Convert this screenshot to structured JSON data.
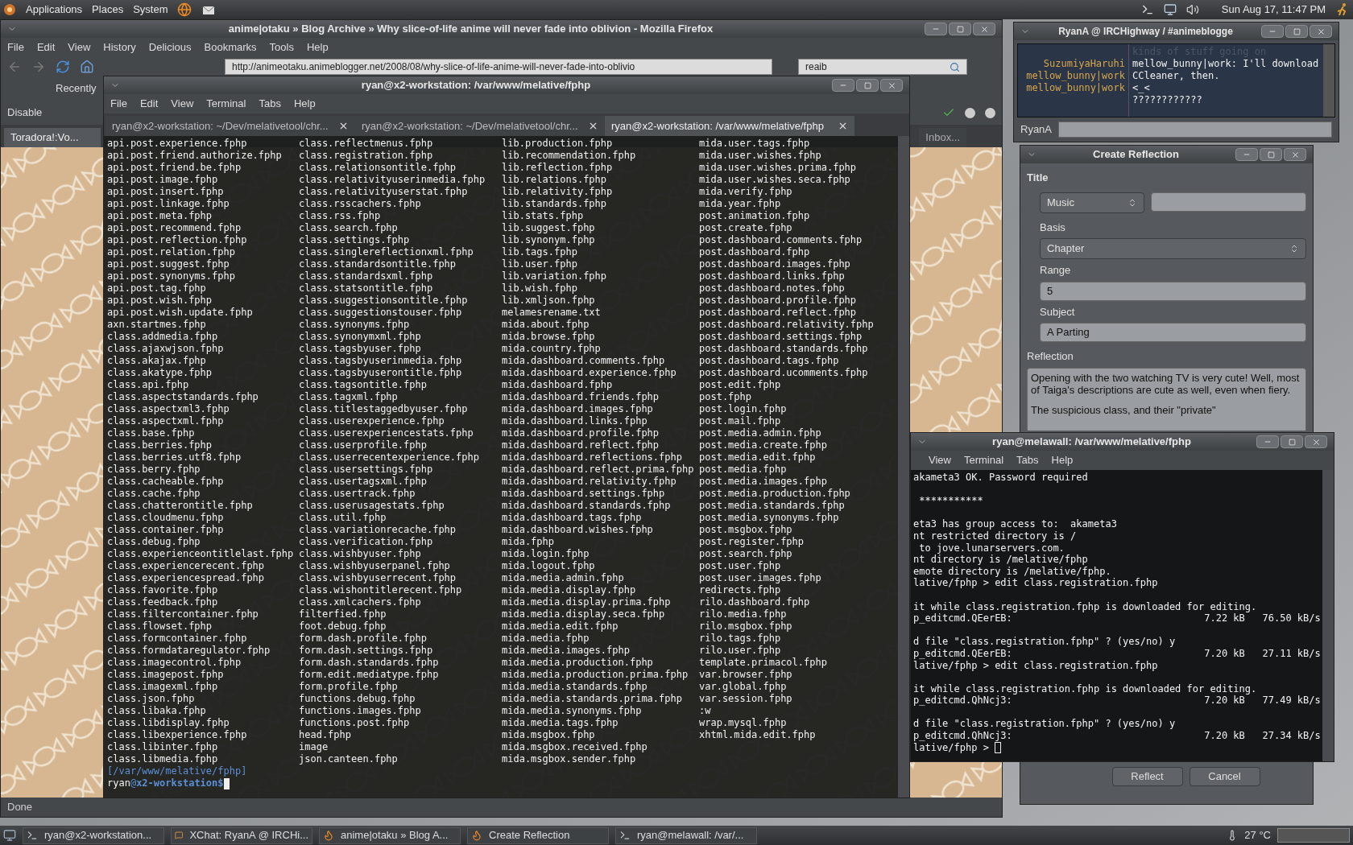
{
  "top_panel": {
    "menus": [
      "Applications",
      "Places",
      "System"
    ],
    "clock": "Sun Aug 17, 11:47 PM"
  },
  "firefox": {
    "title": "anime|otaku » Blog Archive » Why slice-of-life anime will never fade into oblivion - Mozilla Firefox",
    "menu": [
      "File",
      "Edit",
      "View",
      "History",
      "Delicious",
      "Bookmarks",
      "Tools",
      "Help"
    ],
    "url": "http://animeotaku.animeblogger.net/2008/08/why-slice-of-life-anime-will-never-fade-into-oblivio",
    "search": "reaib",
    "bookmark": "Recently",
    "toolbar_button": "Disable",
    "tabs": [
      {
        "label": "Toradora!:Vo...",
        "selected": true
      },
      {
        "label": "Inbox...",
        "selected": false
      }
    ],
    "status": "Done"
  },
  "terminal": {
    "title": "ryan@x2-workstation: /var/www/melative/fphp",
    "menu": [
      "File",
      "Edit",
      "View",
      "Terminal",
      "Tabs",
      "Help"
    ],
    "tabs": [
      {
        "label": "ryan@x2-workstation: ~/Dev/melativetool/chr...",
        "selected": false
      },
      {
        "label": "ryan@x2-workstation: ~/Dev/melativetool/chr...",
        "selected": false
      },
      {
        "label": "ryan@x2-workstation: /var/www/melative/fphp",
        "selected": true
      }
    ],
    "columns": [
      [
        "api.post.experience.fphp",
        "api.post.friend.authorize.fphp",
        "api.post.friend.be.fphp",
        "api.post.image.fphp",
        "api.post.insert.fphp",
        "api.post.linkage.fphp",
        "api.post.meta.fphp",
        "api.post.recommend.fphp",
        "api.post.reflection.fphp",
        "api.post.relation.fphp",
        "api.post.suggest.fphp",
        "api.post.synonyms.fphp",
        "api.post.tag.fphp",
        "api.post.wish.fphp",
        "api.post.wish.update.fphp",
        "axn.startmes.fphp",
        "class.addmedia.fphp",
        "class.ajaxwjson.fphp",
        "class.akajax.fphp",
        "class.akatype.fphp",
        "class.api.fphp",
        "class.aspectstandards.fphp",
        "class.aspectxml3.fphp",
        "class.aspectxml.fphp",
        "class.base.fphp",
        "class.berries.fphp",
        "class.berries.utf8.fphp",
        "class.berry.fphp",
        "class.cacheable.fphp",
        "class.cache.fphp",
        "class.chatterontitle.fphp",
        "class.cloudmenu.fphp",
        "class.container.fphp",
        "class.debug.fphp",
        "class.experienceontitlelast.fphp",
        "class.experiencerecent.fphp",
        "class.experiencespread.fphp",
        "class.favorite.fphp",
        "class.feedback.fphp",
        "class.filtercontainer.fphp",
        "class.flowset.fphp",
        "class.formcontainer.fphp",
        "class.formdataregulator.fphp",
        "class.imagecontrol.fphp",
        "class.imagepost.fphp",
        "class.imagexml.fphp",
        "class.json.fphp",
        "class.libaka.fphp",
        "class.libdisplay.fphp",
        "class.libexperience.fphp",
        "class.libinter.fphp",
        "class.libmedia.fphp"
      ],
      [
        "class.reflectmenus.fphp",
        "class.registration.fphp",
        "class.relationsontitle.fphp",
        "class.relativityuserinmedia.fphp",
        "class.relativityuserstat.fphp",
        "class.rsscachers.fphp",
        "class.rss.fphp",
        "class.search.fphp",
        "class.settings.fphp",
        "class.singlereflectionxml.fphp",
        "class.standardsontitle.fphp",
        "class.standardsxml.fphp",
        "class.statsontitle.fphp",
        "class.suggestionsontitle.fphp",
        "class.suggestionstouser.fphp",
        "class.synonyms.fphp",
        "class.synonymxml.fphp",
        "class.tagsbyuser.fphp",
        "class.tagsbyuserinmedia.fphp",
        "class.tagsbyuserontitle.fphp",
        "class.tagsontitle.fphp",
        "class.tagxml.fphp",
        "class.titlestaggedbyuser.fphp",
        "class.userexperience.fphp",
        "class.userexperiencestats.fphp",
        "class.userprofile.fphp",
        "class.userrecentexperience.fphp",
        "class.usersettings.fphp",
        "class.usertagsxml.fphp",
        "class.usertrack.fphp",
        "class.userusagestats.fphp",
        "class.util.fphp",
        "class.variationrecache.fphp",
        "class.verification.fphp",
        "class.wishbyuser.fphp",
        "class.wishbyuserpanel.fphp",
        "class.wishbyuserrecent.fphp",
        "class.wishontitlerecent.fphp",
        "class.xmlcachers.fphp",
        "filterfied.fphp",
        "foot.debug.fphp",
        "form.dash.profile.fphp",
        "form.dash.settings.fphp",
        "form.dash.standards.fphp",
        "form.edit.mediatype.fphp",
        "form.profile.fphp",
        "functions.debug.fphp",
        "functions.images.fphp",
        "functions.post.fphp",
        "head.fphp",
        "image",
        "json.canteen.fphp"
      ],
      [
        "lib.production.fphp",
        "lib.recommendation.fphp",
        "lib.reflection.fphp",
        "lib.relations.fphp",
        "lib.relativity.fphp",
        "lib.standards.fphp",
        "lib.stats.fphp",
        "lib.suggest.fphp",
        "lib.synonym.fphp",
        "lib.tags.fphp",
        "lib.user.fphp",
        "lib.variation.fphp",
        "lib.wish.fphp",
        "lib.xmljson.fphp",
        "melamesrename.txt",
        "mida.about.fphp",
        "mida.browse.fphp",
        "mida.country.fphp",
        "mida.dashboard.comments.fphp",
        "mida.dashboard.experience.fphp",
        "mida.dashboard.fphp",
        "mida.dashboard.friends.fphp",
        "mida.dashboard.images.fphp",
        "mida.dashboard.links.fphp",
        "mida.dashboard.profile.fphp",
        "mida.dashboard.reflect.fphp",
        "mida.dashboard.reflections.fphp",
        "mida.dashboard.reflect.prima.fphp",
        "mida.dashboard.relativity.fphp",
        "mida.dashboard.settings.fphp",
        "mida.dashboard.standards.fphp",
        "mida.dashboard.tags.fphp",
        "mida.dashboard.wishes.fphp",
        "mida.fphp",
        "mida.login.fphp",
        "mida.logout.fphp",
        "mida.media.admin.fphp",
        "mida.media.display.fphp",
        "mida.media.display.prima.fphp",
        "mida.media.display.seca.fphp",
        "mida.media.edit.fphp",
        "mida.media.fphp",
        "mida.media.images.fphp",
        "mida.media.production.fphp",
        "mida.media.production.prima.fphp",
        "mida.media.standards.fphp",
        "mida.media.standards.prima.fphp",
        "mida.media.synonyms.fphp",
        "mida.media.tags.fphp",
        "mida.msgbox.fphp",
        "mida.msgbox.received.fphp",
        "mida.msgbox.sender.fphp"
      ],
      [
        "mida.user.tags.fphp",
        "mida.user.wishes.fphp",
        "mida.user.wishes.prima.fphp",
        "mida.user.wishes.seca.fphp",
        "mida.verify.fphp",
        "mida.year.fphp",
        "post.animation.fphp",
        "post.create.fphp",
        "post.dashboard.comments.fphp",
        "post.dashboard.fphp",
        "post.dashboard.images.fphp",
        "post.dashboard.links.fphp",
        "post.dashboard.notes.fphp",
        "post.dashboard.profile.fphp",
        "post.dashboard.reflect.fphp",
        "post.dashboard.relativity.fphp",
        "post.dashboard.settings.fphp",
        "post.dashboard.standards.fphp",
        "post.dashboard.tags.fphp",
        "post.dashboard.ucomments.fphp",
        "post.edit.fphp",
        "post.fphp",
        "post.login.fphp",
        "post.mail.fphp",
        "post.media.admin.fphp",
        "post.media.create.fphp",
        "post.media.edit.fphp",
        "post.media.fphp",
        "post.media.images.fphp",
        "post.media.production.fphp",
        "post.media.standards.fphp",
        "post.media.synonyms.fphp",
        "post.msgbox.fphp",
        "post.register.fphp",
        "post.search.fphp",
        "post.user.fphp",
        "post.user.images.fphp",
        "redirects.fphp",
        "rilo.dashboard.fphp",
        "rilo.media.fphp",
        "rilo.msgbox.fphp",
        "rilo.tags.fphp",
        "rilo.user.fphp",
        "template.primacol.fphp",
        "var.browser.fphp",
        "var.global.fphp",
        "var.session.fphp",
        ":w",
        "wrap.mysql.fphp",
        "xhtml.mida.edit.fphp"
      ]
    ],
    "path": "[/var/www/melative/fphp]",
    "prompt_user": "ryan",
    "prompt_at": "@",
    "prompt_host": "x2-workstation$"
  },
  "irc": {
    "title": "RyanA @ IRCHighway / #animeblogge",
    "messages": [
      {
        "text": "kinds of stuff going on",
        "kind": "faded"
      },
      {
        "nick": "SuzumiyaHaruhi",
        "text": "mellow_bunny|work: I'll download CCleaner, then.",
        "kind": "normal"
      },
      {
        "nick": "mellow_bunny|work",
        "text": "<_<",
        "kind": "normal"
      },
      {
        "nick": "mellow_bunny|work",
        "text": "????????????",
        "kind": "normal"
      }
    ],
    "own_nick": "RyanA"
  },
  "reflection": {
    "title": "Create Reflection",
    "title_label": "Title",
    "category": "Music",
    "basis_label": "Basis",
    "basis": "Chapter",
    "range_label": "Range",
    "range": "5",
    "subject_label": "Subject",
    "subject": "A Parting",
    "reflection_label": "Reflection",
    "reflection_paragraphs": [
      "Opening with the two watching TV is very cute! Well, most of Taiga's descriptions are cute as well, even when fiery.",
      "The suspicious class, and their \"private\""
    ],
    "buttons": [
      "Reflect",
      "Cancel"
    ]
  },
  "melawall": {
    "title": "ryan@melawall: /var/www/melative/fphp",
    "menu": [
      "View",
      "Terminal",
      "Tabs",
      "Help"
    ],
    "blocks": [
      [
        "akameta3 OK. Password required"
      ],
      [
        " ***********"
      ],
      [
        "eta3 has group access to:  akameta3",
        "nt restricted directory is /",
        " to jove.lunarservers.com.",
        "nt directory is /melative/fphp",
        "emote directory is /melative/fphp.",
        "lative/fphp > edit class.registration.fphp"
      ],
      [
        "it while class.registration.fphp is downloaded for editing.",
        "p_editcmd.QEerEB:                                 7.22 kB   76.50 kB/s"
      ],
      [
        "d file \"class.registration.fphp\" ? (yes/no) y",
        "p_editcmd.QEerEB:                                 7.20 kB   27.11 kB/s",
        "lative/fphp > edit class.registration.fphp"
      ],
      [
        "it while class.registration.fphp is downloaded for editing.",
        "p_editcmd.QhNcj3:                                 7.20 kB   77.49 kB/s"
      ],
      [
        "d file \"class.registration.fphp\" ? (yes/no) y",
        "p_editcmd.QhNcj3:                                 7.20 kB   27.34 kB/s",
        "lative/fphp > "
      ]
    ]
  },
  "taskbar": {
    "items": [
      {
        "label": "ryan@x2-workstation...",
        "kind": "terminal"
      },
      {
        "label": "XChat: RyanA @ IRCHi...",
        "kind": "chat"
      },
      {
        "label": "anime|otaku » Blog A...",
        "kind": "browser"
      },
      {
        "label": "Create Reflection",
        "kind": "browser"
      },
      {
        "label": "ryan@melawall: /var/...",
        "kind": "terminal"
      }
    ],
    "temperature": "27 °C"
  }
}
